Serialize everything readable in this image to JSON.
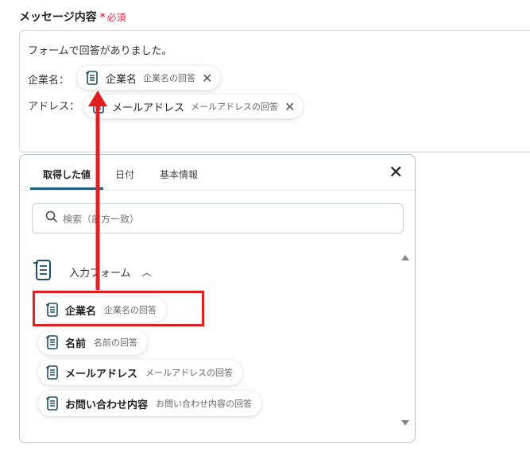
{
  "field": {
    "label": "メッセージ内容",
    "required_star": "*",
    "required_text": "必須"
  },
  "editor": {
    "line1": "フォームで回答がありました。",
    "line2_label": "企業名：",
    "line3_label": "アドレス：",
    "chips": [
      {
        "name": "企業名",
        "sub": "企業名の回答",
        "close": "✕"
      },
      {
        "name": "メールアドレス",
        "sub": "メールアドレスの回答",
        "close": "✕"
      }
    ]
  },
  "panel": {
    "tabs": [
      {
        "label": "取得した値"
      },
      {
        "label": "日付"
      },
      {
        "label": "基本情報"
      }
    ],
    "close": "✕",
    "search_placeholder": "検索（前方一致）",
    "group_title": "入力フォーム",
    "group_chevron": "︿",
    "items": [
      {
        "name": "企業名",
        "sub": "企業名の回答"
      },
      {
        "name": "名前",
        "sub": "名前の回答"
      },
      {
        "name": "メールアドレス",
        "sub": "メールアドレスの回答"
      },
      {
        "name": "お問い合わせ内容",
        "sub": "お問い合わせ内容の回答"
      }
    ]
  },
  "colors": {
    "accent": "#1f5e78",
    "highlight": "#e02020",
    "required": "#e0334b"
  }
}
